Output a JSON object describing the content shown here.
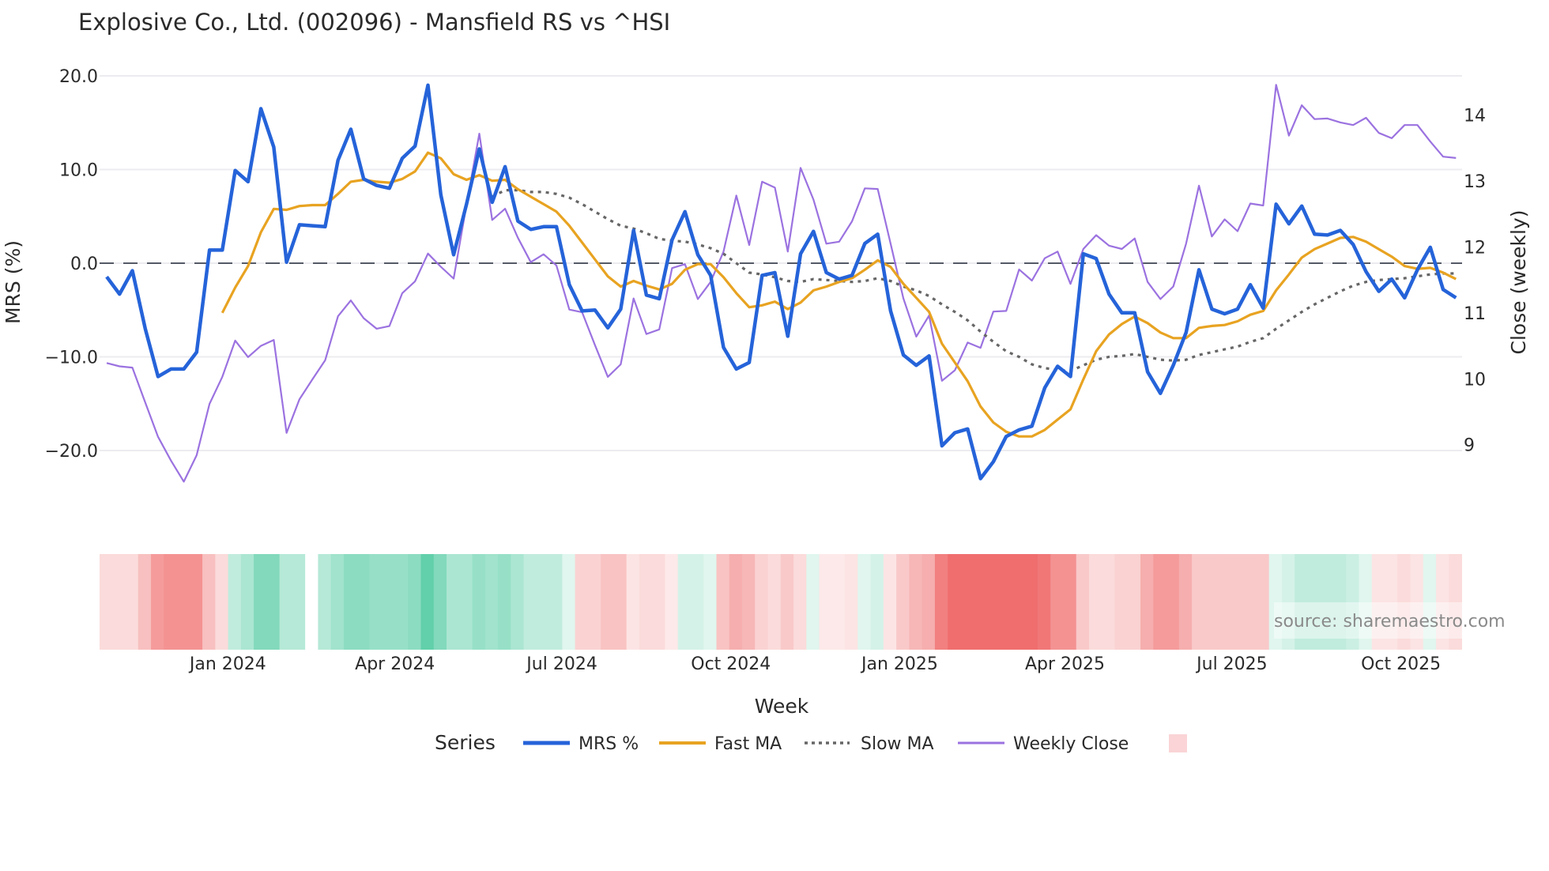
{
  "chart_data": {
    "type": "line",
    "title": "Explosive Co., Ltd. (002096) - Mansfield RS vs ^HSI",
    "xlabel": "Week",
    "ylabel": "MRS (%)",
    "y2label": "Close (weekly)",
    "ylim": [
      -20,
      20
    ],
    "y2lim": [
      9,
      14
    ],
    "yticks": [
      "20.0",
      "10.0",
      "0.0",
      "−10.0",
      "−20.0"
    ],
    "ytick_values": [
      20,
      10,
      0,
      -10,
      -20
    ],
    "y2ticks": [
      "14",
      "13",
      "12",
      "11",
      "10",
      "9"
    ],
    "y2tick_values": [
      14,
      13,
      12,
      11,
      10,
      9
    ],
    "x_start": "2023-10-27",
    "x_frequency": "weekly",
    "xticks": [
      {
        "label": "Jan 2024",
        "date": "2024-01-01"
      },
      {
        "label": "Apr 2024",
        "date": "2024-04-01"
      },
      {
        "label": "Jul 2024",
        "date": "2024-07-01"
      },
      {
        "label": "Oct 2024",
        "date": "2024-10-01"
      },
      {
        "label": "Jan 2025",
        "date": "2025-01-01"
      },
      {
        "label": "Apr 2025",
        "date": "2025-04-01"
      },
      {
        "label": "Jul 2025",
        "date": "2025-07-01"
      },
      {
        "label": "Oct 2025",
        "date": "2025-10-01"
      }
    ],
    "zero_line": 0,
    "grid": true,
    "legend_title": "Series",
    "legend_position": "bottom-center",
    "series": [
      {
        "name": "MRS %",
        "color": "#2563d9",
        "axis": "left",
        "style": "solid",
        "values": [
          -1.45,
          -3.3,
          -0.8,
          -7.0,
          -12.1,
          -11.3,
          -11.3,
          -9.5,
          1.4,
          1.4,
          9.9,
          8.7,
          16.5,
          12.4,
          0.1,
          4.1,
          4.0,
          3.9,
          11.0,
          14.3,
          9.0,
          8.3,
          8.0,
          11.2,
          12.5,
          19.0,
          7.3,
          0.9,
          6.3,
          12.2,
          6.5,
          10.3,
          4.5,
          3.6,
          3.9,
          3.9,
          -2.3,
          -5.1,
          -5.0,
          -6.9,
          -4.9,
          3.5,
          -3.4,
          -3.8,
          2.5,
          5.5,
          0.9,
          -1.3,
          -9.0,
          -11.3,
          -10.6,
          -1.3,
          -1.0,
          -7.8,
          1.0,
          3.4,
          -1.0,
          -1.7,
          -1.3,
          2.1,
          3.1,
          -5.1,
          -9.8,
          -10.9,
          -9.9,
          -19.5,
          -18.1,
          -17.7,
          -23.0,
          -21.2,
          -18.5,
          -17.8,
          -17.4,
          -13.3,
          -11.0,
          -12.1,
          1.0,
          0.5,
          -3.3,
          -5.3,
          -5.3,
          -11.6,
          -13.9,
          -10.9,
          -7.4,
          -0.7,
          -4.9,
          -5.4,
          -4.9,
          -2.3,
          -4.8,
          6.3,
          4.2,
          6.1,
          3.1,
          3.0,
          3.5,
          2.0,
          -0.9,
          -3.0,
          -1.7,
          -3.7,
          -0.7,
          1.7,
          -2.8,
          -3.7
        ]
      },
      {
        "name": "Fast MA",
        "color": "#e8a321",
        "axis": "left",
        "style": "solid",
        "values": [
          null,
          null,
          null,
          null,
          null,
          null,
          null,
          null,
          null,
          -5.3,
          -2.6,
          -0.3,
          3.3,
          5.8,
          5.7,
          6.1,
          6.2,
          6.2,
          7.4,
          8.7,
          8.9,
          8.7,
          8.6,
          9.0,
          9.8,
          11.8,
          11.2,
          9.5,
          8.9,
          9.4,
          8.8,
          8.9,
          7.9,
          7.1,
          6.3,
          5.5,
          4.0,
          2.2,
          0.4,
          -1.4,
          -2.5,
          -1.9,
          -2.4,
          -2.8,
          -2.2,
          -0.7,
          -0.1,
          -0.1,
          -1.5,
          -3.2,
          -4.7,
          -4.5,
          -4.1,
          -4.9,
          -4.2,
          -2.9,
          -2.5,
          -2.0,
          -1.6,
          -0.7,
          0.3,
          -0.4,
          -2.2,
          -3.7,
          -5.2,
          -8.6,
          -10.6,
          -12.6,
          -15.3,
          -17.0,
          -18.0,
          -18.5,
          -18.5,
          -17.8,
          -16.7,
          -15.6,
          -12.4,
          -9.4,
          -7.6,
          -6.5,
          -5.7,
          -6.4,
          -7.4,
          -8.0,
          -8.0,
          -6.9,
          -6.7,
          -6.6,
          -6.2,
          -5.5,
          -5.1,
          -2.9,
          -1.2,
          0.6,
          1.5,
          2.1,
          2.7,
          2.8,
          2.3,
          1.5,
          0.7,
          -0.3,
          -0.6,
          -0.5,
          -1.0,
          -1.7
        ]
      },
      {
        "name": "Slow MA",
        "color": "#666666",
        "axis": "left",
        "style": "dotted",
        "values": [
          null,
          null,
          null,
          null,
          null,
          null,
          null,
          null,
          null,
          null,
          null,
          null,
          null,
          null,
          null,
          null,
          null,
          null,
          null,
          null,
          null,
          null,
          null,
          null,
          null,
          null,
          null,
          null,
          null,
          null,
          7.1,
          7.8,
          7.8,
          7.6,
          7.6,
          7.4,
          7.0,
          6.3,
          5.5,
          4.7,
          4.0,
          3.7,
          3.2,
          2.6,
          2.4,
          2.3,
          2.0,
          1.6,
          1.0,
          0.0,
          -1.0,
          -1.2,
          -1.5,
          -1.9,
          -2.0,
          -1.7,
          -1.8,
          -1.9,
          -2.0,
          -1.9,
          -1.6,
          -1.9,
          -2.5,
          -2.9,
          -3.5,
          -4.4,
          -5.2,
          -6.1,
          -7.3,
          -8.4,
          -9.4,
          -10.0,
          -10.8,
          -11.2,
          -11.4,
          -11.5,
          -10.9,
          -10.3,
          -10.0,
          -9.9,
          -9.7,
          -10.0,
          -10.3,
          -10.4,
          -10.3,
          -9.8,
          -9.5,
          -9.2,
          -8.9,
          -8.4,
          -8.0,
          -7.0,
          -6.1,
          -5.2,
          -4.4,
          -3.7,
          -3.0,
          -2.4,
          -2.0,
          -1.8,
          -1.7,
          -1.6,
          -1.4,
          -1.2,
          -1.1,
          -1.1
        ]
      },
      {
        "name": "Weekly Close",
        "color": "#9b72e0",
        "axis": "right",
        "style": "solid",
        "values": [
          10.24,
          10.19,
          10.17,
          9.64,
          9.12,
          8.76,
          8.44,
          8.84,
          9.62,
          10.03,
          10.58,
          10.33,
          10.5,
          10.59,
          9.18,
          9.69,
          9.99,
          10.28,
          10.95,
          11.19,
          10.92,
          10.76,
          10.8,
          11.3,
          11.48,
          11.9,
          11.7,
          11.52,
          12.64,
          13.72,
          12.41,
          12.58,
          12.14,
          11.77,
          11.89,
          11.72,
          11.05,
          11.01,
          10.51,
          10.03,
          10.22,
          11.22,
          10.68,
          10.75,
          11.68,
          11.74,
          11.21,
          11.47,
          11.93,
          12.78,
          12.03,
          12.99,
          12.9,
          11.93,
          13.2,
          12.72,
          12.05,
          12.08,
          12.39,
          12.89,
          12.88,
          12.05,
          11.22,
          10.64,
          10.96,
          9.97,
          10.13,
          10.55,
          10.47,
          11.02,
          11.03,
          11.66,
          11.49,
          11.83,
          11.93,
          11.44,
          11.97,
          12.18,
          12.02,
          11.97,
          12.13,
          11.47,
          11.21,
          11.4,
          12.05,
          12.93,
          12.16,
          12.42,
          12.24,
          12.66,
          12.63,
          14.46,
          13.69,
          14.15,
          13.94,
          13.95,
          13.89,
          13.85,
          13.96,
          13.73,
          13.65,
          13.85,
          13.85,
          13.6,
          13.37,
          13.35
        ]
      }
    ],
    "heatmap": {
      "positive_color": "#2ec08e",
      "negative_color": "#ec4a4a",
      "values": [
        -0.2,
        -0.2,
        -0.2,
        -0.35,
        -0.55,
        -0.6,
        -0.6,
        -0.6,
        -0.35,
        -0.2,
        0.3,
        0.4,
        0.6,
        0.6,
        0.35,
        0.35,
        0,
        0.35,
        0.45,
        0.55,
        0.55,
        0.5,
        0.5,
        0.5,
        0.55,
        0.75,
        0.6,
        0.4,
        0.4,
        0.5,
        0.45,
        0.5,
        0.4,
        0.3,
        0.3,
        0.3,
        0.15,
        -0.25,
        -0.25,
        -0.33,
        -0.33,
        -0.15,
        -0.2,
        -0.2,
        -0.12,
        0.2,
        0.2,
        0.15,
        -0.33,
        -0.45,
        -0.4,
        -0.25,
        -0.2,
        -0.3,
        -0.2,
        0.15,
        -0.12,
        -0.12,
        -0.15,
        0.15,
        0.2,
        -0.15,
        -0.3,
        -0.4,
        -0.45,
        -0.7,
        -0.8,
        -0.8,
        -0.8,
        -0.8,
        -0.8,
        -0.8,
        -0.8,
        -0.75,
        -0.6,
        -0.6,
        -0.3,
        -0.2,
        -0.2,
        -0.25,
        -0.25,
        -0.45,
        -0.55,
        -0.55,
        -0.45,
        -0.3,
        -0.3,
        -0.3,
        -0.3,
        -0.3,
        -0.3,
        0.15,
        0.2,
        0.3,
        0.3,
        0.3,
        0.3,
        0.25,
        0.15,
        -0.15,
        -0.15,
        -0.2,
        -0.15,
        0.15,
        -0.15,
        -0.2
      ]
    },
    "source": "source: sharemaestro.com"
  }
}
